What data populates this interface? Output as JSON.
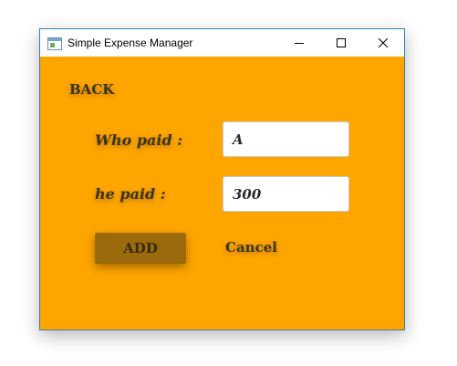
{
  "window": {
    "title": "Simple Expense Manager"
  },
  "form": {
    "back_label": "BACK",
    "who_paid_label": "Who paid :",
    "who_paid_value": "A",
    "he_paid_label": "he paid :",
    "he_paid_value": "300",
    "add_label": "ADD",
    "cancel_label": "Cancel"
  },
  "colors": {
    "background": "#ffa500",
    "add_button": "#9a6a0b",
    "text": "#3a3320"
  },
  "icons": [
    "app-icon",
    "minimize-icon",
    "maximize-icon",
    "close-icon"
  ]
}
